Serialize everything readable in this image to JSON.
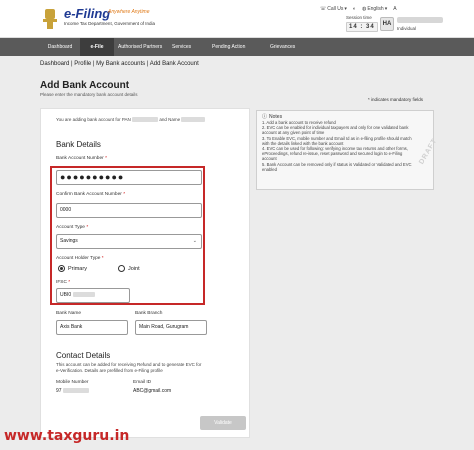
{
  "header": {
    "logo_title": "e-Filing",
    "logo_tagline": "Anywhere Anytime",
    "logo_sub": "Income Tax Department, Government of India",
    "call_us": "Call Us",
    "language": "English",
    "session_label": "Session time",
    "session_time": "14 : 34",
    "avatar_initials": "HA",
    "user_type": "Individual"
  },
  "nav": [
    {
      "label": "Dashboard"
    },
    {
      "label": "e-File"
    },
    {
      "label": "Authorised Partners"
    },
    {
      "label": "Services"
    },
    {
      "label": "Pending Action"
    },
    {
      "label": "Grievances"
    }
  ],
  "breadcrumb": "Dashboard  |  Profile  |  My Bank accounts  |  Add Bank Account",
  "page": {
    "title": "Add Bank Account",
    "subtitle": "Please enter the mandatory bank account details",
    "mandatory_note": "* indicates mandatory fields",
    "pan_note_prefix": "You are adding bank account for PAN",
    "pan_note_mid": "and Name"
  },
  "bank_details": {
    "title": "Bank Details",
    "account_number_label": "Bank Account Number",
    "account_number_value": "●●●●●●●●●●",
    "confirm_label": "Confirm Bank Account Number",
    "confirm_value": "0000",
    "account_type_label": "Account Type",
    "account_type_value": "Savings",
    "holder_type_label": "Account Holder Type",
    "holder_primary": "Primary",
    "holder_joint": "Joint",
    "ifsc_label": "IFSC",
    "ifsc_value": "UBI0",
    "bank_name_label": "Bank Name",
    "bank_name_value": "Axis Bank",
    "bank_branch_label": "Bank Branch",
    "bank_branch_value": "Main Road, Gurugram"
  },
  "contact": {
    "title": "Contact Details",
    "note": "This account can be added for receiving Refund and to generate EVC for e-Verification. Details are prefilled from e-Filing profile",
    "mobile_label": "Mobile Number",
    "mobile_value": "97",
    "email_label": "Email ID",
    "email_value": "ABC@gmail.com"
  },
  "notes": {
    "title": "Notes",
    "items": [
      "1. Add a bank account to receive refund",
      "2. EVC can be enabled for individual taxpayers and only for one validated bank account at any given point of time",
      "3. To Enable EVC, mobile number and Email Id as in e-filing profile should match with the details linked with the bank account",
      "4. EVC can be used for following: verifying income tax returns and other forms, eProceedings, refund re-issue, reset password and secured login to e-Filing account",
      "5. Bank Account can be removed only if status is Validated or Validated and EVC enabled"
    ],
    "draft": "DRAFT"
  },
  "actions": {
    "validate": "Validate"
  },
  "watermark": "www.taxguru.in",
  "colors": {
    "primary": "#1f3a93",
    "accent": "#e07b1a",
    "nav": "#5a5a5a",
    "highlight": "#c62828"
  }
}
